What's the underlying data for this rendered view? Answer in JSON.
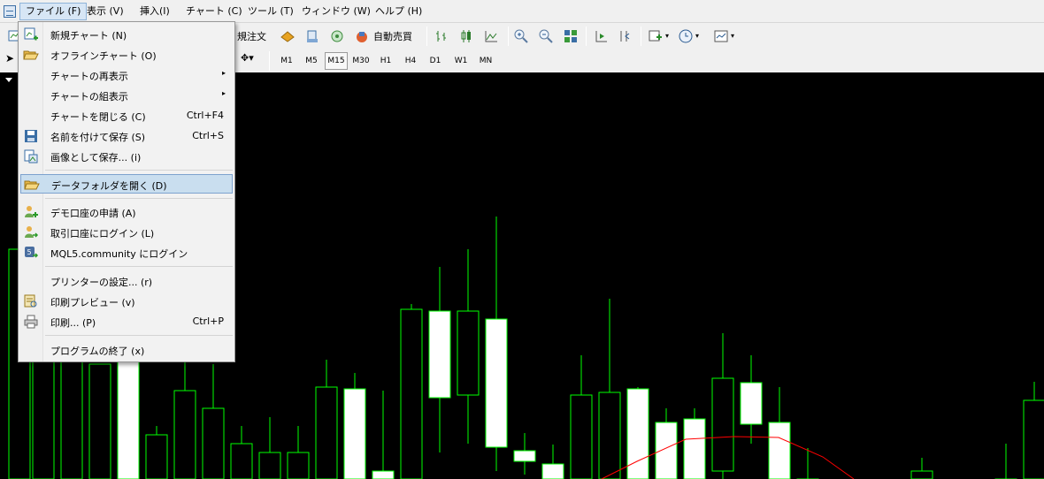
{
  "menubar": {
    "items": [
      "ファイル (F)",
      "表示 (V)",
      "挿入(I)",
      "チャート (C)",
      "ツール (T)",
      "ウィンドウ (W)",
      "ヘルプ (H)"
    ],
    "active_index": 0
  },
  "toolbar": {
    "new_order_label": "規注文",
    "auto_trade_label": "自動売買",
    "timeframes": [
      "M1",
      "M5",
      "M15",
      "M30",
      "H1",
      "H4",
      "D1",
      "W1",
      "MN"
    ],
    "active_timeframe": "M15"
  },
  "file_menu": {
    "items": [
      {
        "label": "新規チャート (N)",
        "shortcut": "",
        "icon": "new-chart-icon"
      },
      {
        "label": "オフラインチャート (O)",
        "shortcut": "",
        "icon": "folder-open-icon"
      },
      {
        "label": "チャートの再表示",
        "shortcut": "",
        "icon": "",
        "submenu": true
      },
      {
        "label": "チャートの組表示",
        "shortcut": "",
        "icon": "",
        "submenu": true
      },
      {
        "label": "チャートを閉じる (C)",
        "shortcut": "Ctrl+F4",
        "icon": ""
      },
      {
        "label": "名前を付けて保存 (S)",
        "shortcut": "Ctrl+S",
        "icon": "save-icon"
      },
      {
        "label": "画像として保存... (i)",
        "shortcut": "",
        "icon": "save-image-icon"
      },
      {
        "label": "データフォルダを開く (D)",
        "shortcut": "",
        "icon": "folder-icon",
        "highlighted": true
      },
      {
        "label": "デモ口座の申請 (A)",
        "shortcut": "",
        "icon": "demo-account-icon"
      },
      {
        "label": "取引口座にログイン (L)",
        "shortcut": "",
        "icon": "login-icon"
      },
      {
        "label": "MQL5.community にログイン",
        "shortcut": "",
        "icon": "mql5-login-icon"
      },
      {
        "label": "プリンターの設定... (r)",
        "shortcut": "",
        "icon": ""
      },
      {
        "label": "印刷プレビュー (v)",
        "shortcut": "",
        "icon": "print-preview-icon"
      },
      {
        "label": "印刷... (P)",
        "shortcut": "Ctrl+P",
        "icon": "printer-icon"
      },
      {
        "label": "プログラムの終了 (x)",
        "shortcut": "",
        "icon": ""
      }
    ]
  },
  "colors": {
    "chart_bg": "#000000",
    "candle_line": "#00ff00",
    "bull_fill": "#ffffff",
    "bear_fill": "#000000",
    "moving_average": "#ff0000",
    "menu_highlight": "#c9deef"
  }
}
